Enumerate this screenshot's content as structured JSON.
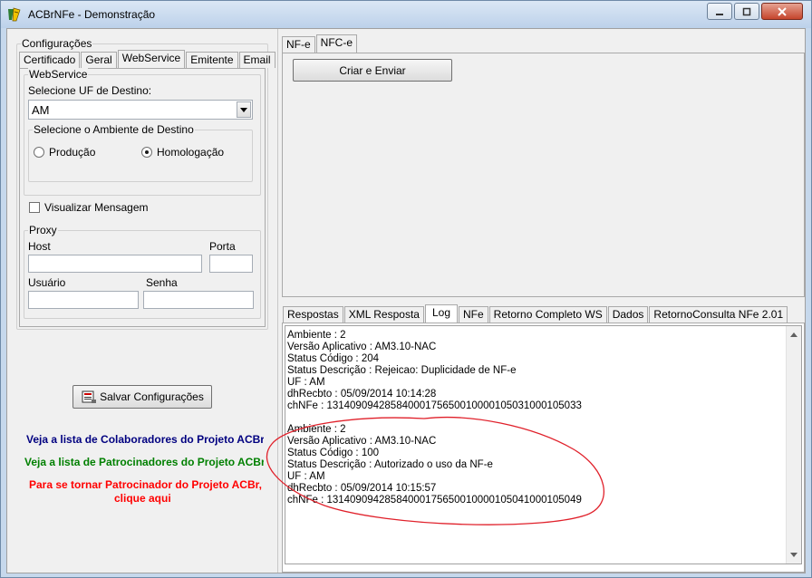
{
  "window": {
    "title": "ACBrNFe - Demonstração"
  },
  "config": {
    "group_label": "Configurações",
    "tabs": [
      "Certificado",
      "Geral",
      "WebService",
      "Emitente",
      "Email"
    ],
    "active_tab": "WebService",
    "webservice": {
      "group_label": "WebService",
      "uf_label": "Selecione UF de Destino:",
      "uf_value": "AM",
      "ambiente_label": "Selecione o Ambiente de Destino",
      "producao_label": "Produção",
      "homologacao_label": "Homologação",
      "selected_ambiente": "Homologação",
      "visualizar_label": "Visualizar Mensagem",
      "visualizar_checked": false
    },
    "proxy": {
      "group_label": "Proxy",
      "host_label": "Host",
      "porta_label": "Porta",
      "usuario_label": "Usuário",
      "senha_label": "Senha",
      "host_value": "",
      "porta_value": "",
      "usuario_value": "",
      "senha_value": ""
    },
    "save_label": "Salvar Configurações"
  },
  "links": {
    "colaboradores": "Veja a lista de Colaboradores do Projeto ACBr",
    "patrocinadores": "Veja a lista de Patrocinadores do Projeto ACBr",
    "patrocinador_line1": "Para se tornar Patrocinador do Projeto ACBr,",
    "patrocinador_line2": "clique aqui"
  },
  "top_tabs": [
    "NF-e",
    "NFC-e"
  ],
  "active_top_tab": "NFC-e",
  "criar_enviar_label": "Criar e Enviar",
  "bottom_tabs": [
    "Respostas",
    "XML Resposta",
    "Log",
    "NFe",
    "Retorno Completo WS",
    "Dados",
    "RetornoConsulta NFe 2.01"
  ],
  "active_bottom_tab": "Log",
  "log_lines": [
    "Ambiente : 2",
    "Versão Aplicativo : AM3.10-NAC",
    "Status Código : 204",
    "Status Descrição : Rejeicao: Duplicidade de NF-e",
    "UF : AM",
    "dhRecbto : 05/09/2014 10:14:28",
    "chNFe : 13140909428584000175650010000105031000105033",
    "",
    "Ambiente : 2",
    "Versão Aplicativo : AM3.10-NAC",
    "Status Código : 100",
    "Status Descrição : Autorizado o uso da NF-e",
    "UF : AM",
    "dhRecbto : 05/09/2014 10:15:57",
    "chNFe : 13140909428584000175650010000105041000105049"
  ],
  "colors": {
    "link_blue": "#000080",
    "link_green": "#008000",
    "link_red": "#ff0000",
    "annotation_red": "#e0202a"
  }
}
